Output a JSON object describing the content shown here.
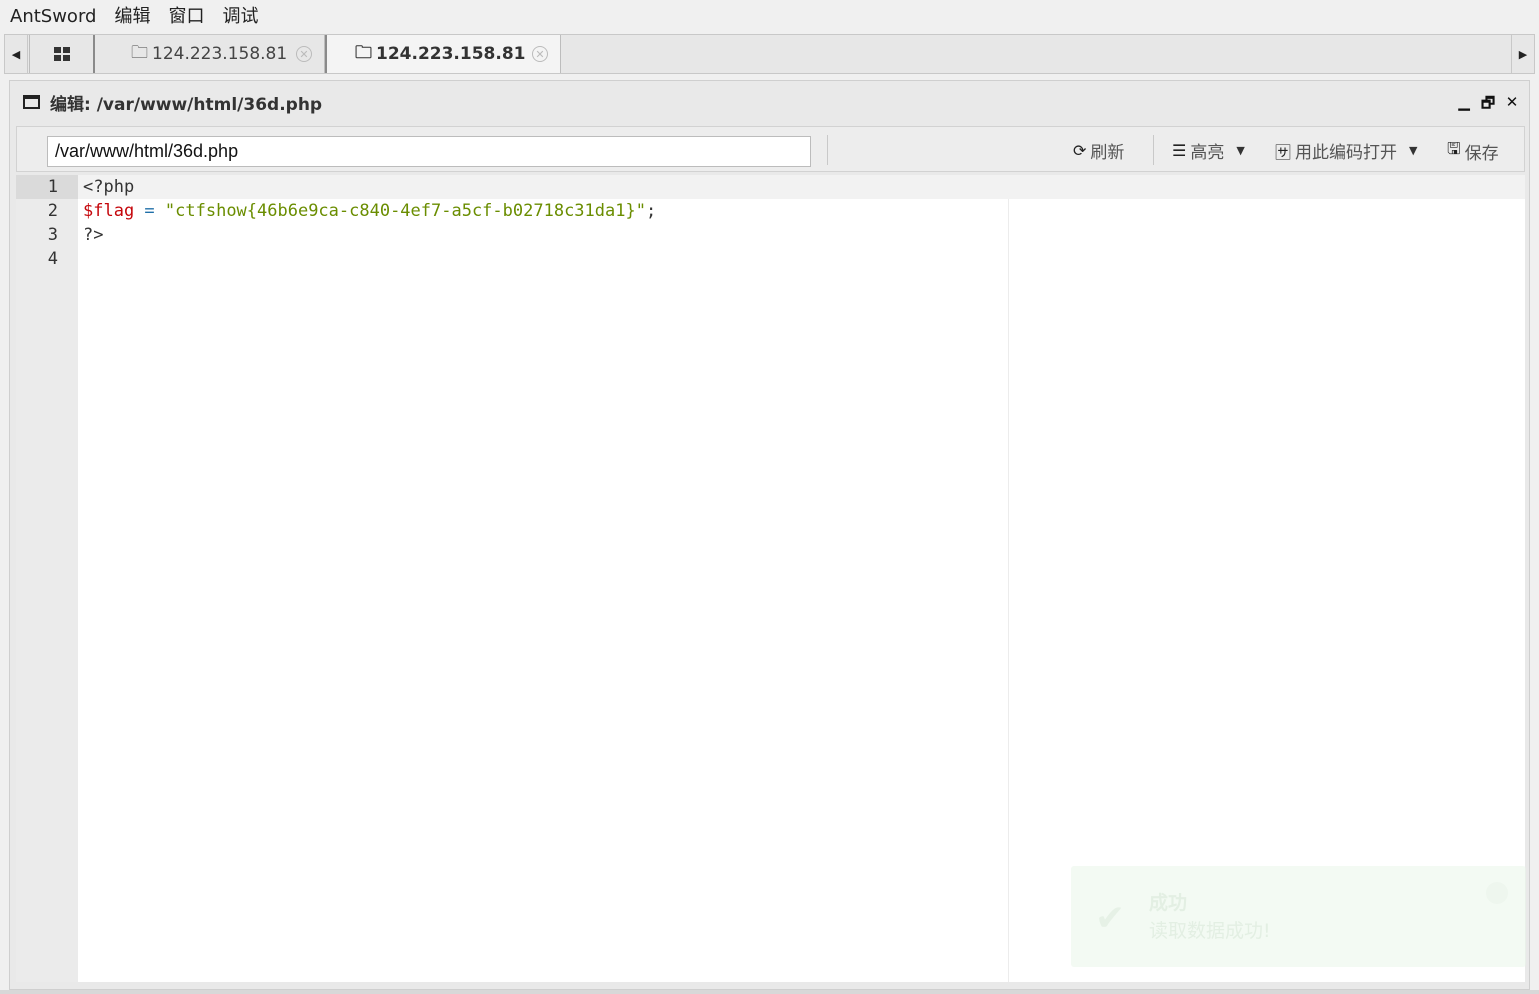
{
  "menu": {
    "app": "AntSword",
    "edit": "编辑",
    "window": "窗口",
    "debug": "调试"
  },
  "tabs": {
    "home_icon": "grid-icon",
    "items": [
      {
        "label": "124.223.158.81",
        "active": false
      },
      {
        "label": "124.223.158.81",
        "active": true
      }
    ]
  },
  "editor_window": {
    "title": "编辑: /var/www/html/36d.php",
    "path_value": "/var/www/html/36d.php",
    "refresh": "刷新",
    "highlight": "高亮",
    "open_with_encoding": "用此编码打开",
    "save": "保存"
  },
  "code": {
    "line_numbers": [
      "1",
      "2",
      "3",
      "4"
    ],
    "line1": "<?php",
    "line2_var": "$flag",
    "line2_op": " = ",
    "line2_str": "\"ctfshow{46b6e9ca-c840-4ef7-a5cf-b02718c31da1}\"",
    "line2_end": ";",
    "line3": "?>",
    "line4": ""
  },
  "toast": {
    "title": "成功",
    "message": "读取数据成功!"
  },
  "colors": {
    "variable": "#c5060b",
    "string": "#6a8d00",
    "operator": "#1f6fa8"
  }
}
